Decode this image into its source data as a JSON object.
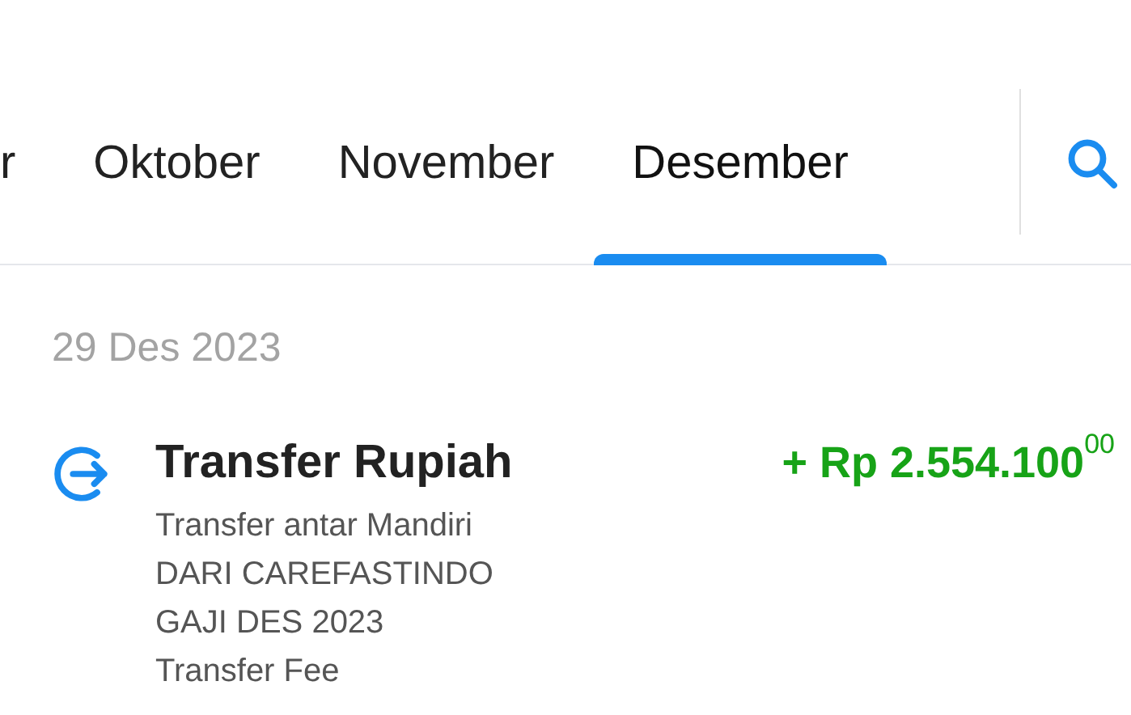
{
  "tabs": [
    {
      "label": "r",
      "selected": false
    },
    {
      "label": "Oktober",
      "selected": false
    },
    {
      "label": "November",
      "selected": false
    },
    {
      "label": "Desember",
      "selected": true
    }
  ],
  "date": "29 Des 2023",
  "transactions": [
    {
      "title": "Transfer Rupiah",
      "amount": "+ Rp 2.554.100$^{00}$",
      "details": [
        "Transfer antar Mandiri",
        "DARI CAREFASTINDO",
        "GAJI DES 2023",
        "Transfer Fee"
      ]
    }
  ]
}
